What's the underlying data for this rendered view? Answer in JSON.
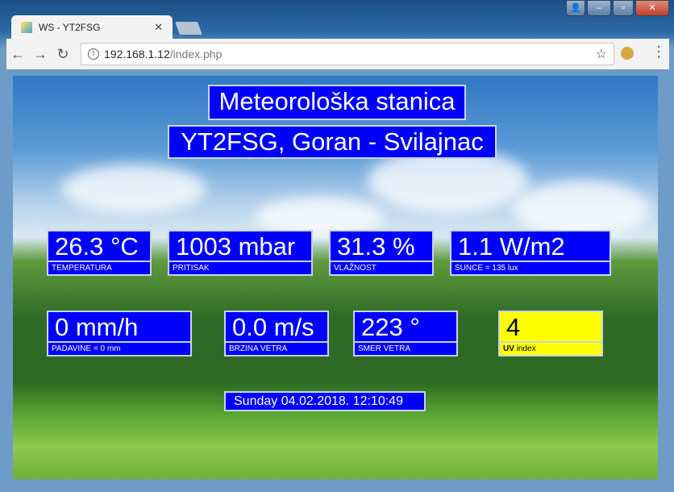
{
  "browser": {
    "tab_title": "WS - YT2FSG",
    "url_host": "192.168.1.12",
    "url_path": "/index.php"
  },
  "page": {
    "title": "Meteorološka stanica",
    "subtitle": "YT2FSG, Goran - Svilajnac",
    "readings": [
      {
        "value": "26.3 °C",
        "label": "TEMPERATURA"
      },
      {
        "value": "1003 mbar",
        "label": "PRITISAK"
      },
      {
        "value": "31.3 %",
        "label": "VLAŽNOST"
      },
      {
        "value": "1.1 W/m2",
        "label": "SUNCE = 135 lux"
      },
      {
        "value": "0 mm/h",
        "label": "PADAVINE = 0 mm"
      },
      {
        "value": "0.0 m/s",
        "label": "BRZINA VETRA"
      },
      {
        "value": "223 °",
        "label": "SMER VETRA"
      },
      {
        "value": "4",
        "label_bold": "UV",
        "label": "index"
      }
    ],
    "datetime": "Sunday 04.02.2018. 12:10:49"
  },
  "colors": {
    "box": "#0000ff",
    "uv": "#ffff00"
  }
}
